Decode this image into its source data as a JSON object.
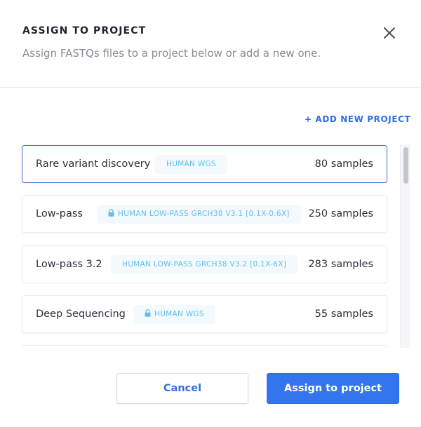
{
  "dialog": {
    "title": "ASSIGN TO PROJECT",
    "subtitle": "Assign FASTQs files to a project below or add a new one.",
    "close_icon": "close-icon"
  },
  "actions": {
    "add_new_project": "+ ADD NEW PROJECT",
    "cancel": "Cancel",
    "assign": "Assign to project"
  },
  "projects": [
    {
      "name": "Rare variant discovery",
      "tag": "HUMAN WGS",
      "locked": false,
      "samples": "80 samples",
      "selected": true
    },
    {
      "name": "Low-pass",
      "tag": "HUMAN LOW-PASS GRCH38 V3.1 [0.1X-0.6X]",
      "locked": true,
      "samples": "250 samples",
      "selected": false
    },
    {
      "name": "Low-pass 3.2",
      "tag": "HUMAN LOW-PASS GRCH38 V3.2 [0.1X-6X]",
      "locked": false,
      "samples": "283 samples",
      "selected": false
    },
    {
      "name": "Deep Sequencing",
      "tag": "HUMAN WGS",
      "locked": true,
      "samples": "55 samples",
      "selected": false
    },
    {
      "name": "",
      "tag": "",
      "locked": false,
      "samples": "",
      "selected": false
    }
  ],
  "colors": {
    "accent": "#3474ee",
    "selected_border": "#3a6fd8",
    "tag_text": "#5fc0e8",
    "tag_bg": "#f3f9fd"
  }
}
